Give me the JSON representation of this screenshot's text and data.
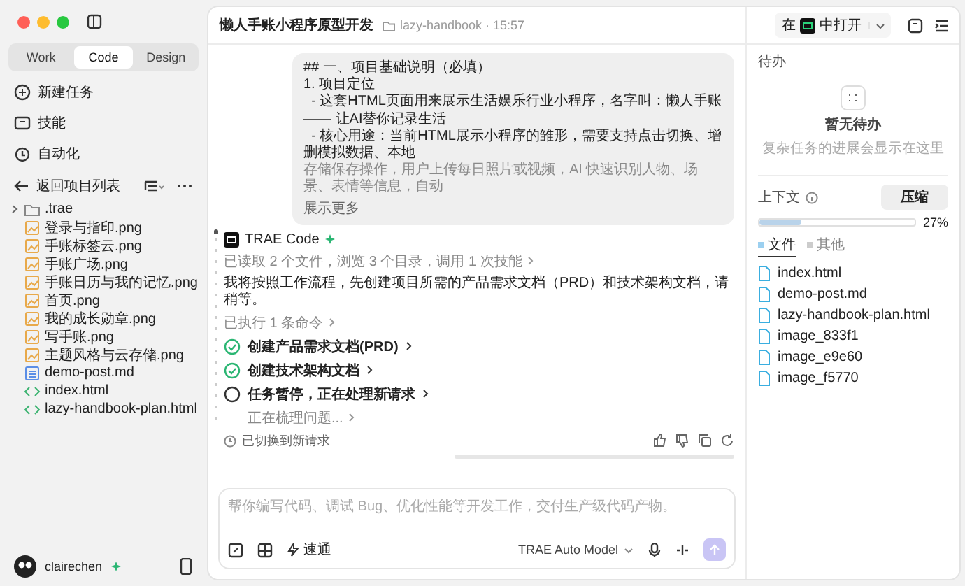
{
  "window": {
    "title": "懒人手账小程序原型开发",
    "folder": "lazy-handbook · 15:57"
  },
  "sidebar": {
    "mode_tabs": [
      {
        "label": "Work",
        "selected": false
      },
      {
        "label": "Code",
        "selected": true
      },
      {
        "label": "Design",
        "selected": false
      }
    ],
    "menu": [
      {
        "label": "新建任务"
      },
      {
        "label": "技能"
      },
      {
        "label": "自动化"
      }
    ],
    "back": "返回项目列表",
    "file_tree": [
      {
        "name": ".trae",
        "kind": "folder",
        "expanded": false
      },
      {
        "name": "登录与指印.png",
        "kind": "image"
      },
      {
        "name": "手账标签云.png",
        "kind": "image"
      },
      {
        "name": "手账广场.png",
        "kind": "image"
      },
      {
        "name": "手账日历与我的记忆.png",
        "kind": "image"
      },
      {
        "name": "首页.png",
        "kind": "image"
      },
      {
        "name": "我的成长勋章.png",
        "kind": "image"
      },
      {
        "name": "写手账.png",
        "kind": "image"
      },
      {
        "name": "主题风格与云存储.png",
        "kind": "image"
      },
      {
        "name": "demo-post.md",
        "kind": "markdown"
      },
      {
        "name": "index.html",
        "kind": "code"
      },
      {
        "name": "lazy-handbook-plan.html",
        "kind": "code"
      }
    ],
    "user": {
      "name": "clairechen"
    }
  },
  "chat": {
    "message": {
      "lines": [
        "## 一、项目基础说明（必填）",
        "1. 项目定位",
        "  - 这套HTML页面用来展示生活娱乐行业小程序，名字叫：懒人手账 —— 让AI替你记录生活",
        "  - 核心用途：当前HTML展示小程序的雏形，需要支持点击切换、增删模拟数据、本地"
      ],
      "faded_line": "存储保存操作，用户上传每日照片或视频，AI 快速识别人物、场景、表情等信息，自动",
      "more": "展示更多"
    },
    "agent": "TRAE Code",
    "read_summary": "已读取 2 个文件，浏览 3 个目录，调用 1 次技能",
    "reply": "我将按照工作流程，先创建项目所需的产品需求文档（PRD）和技术架构文档，请稍等。",
    "exec_summary": "已执行 1 条命令",
    "tasks": [
      {
        "label": "创建产品需求文档(PRD)",
        "done": true
      },
      {
        "label": "创建技术架构文档",
        "done": true
      },
      {
        "label": "任务暂停，正在处理新请求",
        "done": false
      }
    ],
    "thinking": "正在梳理问题...",
    "switched": "已切换到新请求"
  },
  "composer": {
    "placeholder": "帮你编写代码、调试 Bug、优化性能等开发工作，交付生产级代码产物。",
    "mode": "速通",
    "model": "TRAE Auto Model"
  },
  "right": {
    "open_in": {
      "prefix": "在",
      "suffix": "中打开"
    },
    "todo": {
      "title": "待办",
      "empty_title": "暂无待办",
      "empty_desc": "复杂任务的进展会显示在这里"
    },
    "context": {
      "title": "上下文",
      "compress": "压缩",
      "level": 0.27,
      "percent": "27%",
      "tabs": [
        {
          "label": "文件",
          "selected": true
        },
        {
          "label": "其他",
          "selected": false
        }
      ],
      "files": [
        "index.html",
        "demo-post.md",
        "lazy-handbook-plan.html",
        "image_833f1",
        "image_e9e60",
        "image_f5770"
      ]
    }
  }
}
